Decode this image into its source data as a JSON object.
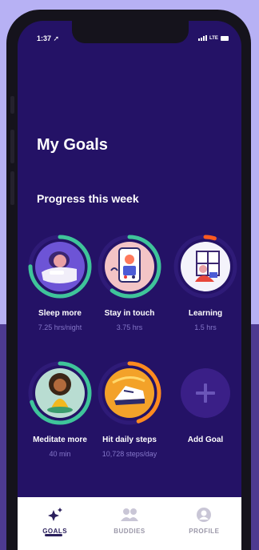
{
  "status": {
    "time": "1:37",
    "network": "LTE"
  },
  "header": {
    "title": "My Goals",
    "subtitle": "Progress this week"
  },
  "goals": [
    {
      "label": "Sleep more",
      "value": "7.25 hrs/night",
      "progress": 0.75,
      "icon": "sleeping-person-icon",
      "color": "#3fc49a"
    },
    {
      "label": "Stay in touch",
      "value": "3.75 hrs",
      "progress": 0.6,
      "icon": "video-call-phone-icon",
      "color": "#3fc49a"
    },
    {
      "label": "Learning",
      "value": "1.5 hrs",
      "progress": 0.05,
      "icon": "reading-person-icon",
      "color": "#ff5a1f"
    },
    {
      "label": "Meditate more",
      "value": "40 min",
      "progress": 0.7,
      "icon": "meditating-person-icon",
      "color": "#3fc49a"
    },
    {
      "label": "Hit daily steps",
      "value": "10,728 steps/day",
      "progress": 0.45,
      "icon": "shoe-steps-icon",
      "color": "#ff8a1f"
    },
    {
      "label": "Add Goal",
      "value": "",
      "icon": "plus-icon"
    }
  ],
  "tabs": [
    {
      "label": "GOALS",
      "icon": "sparkle-star-icon",
      "active": true
    },
    {
      "label": "BUDDIES",
      "icon": "buddies-icon",
      "active": false
    },
    {
      "label": "PROFILE",
      "icon": "profile-icon",
      "active": false
    }
  ]
}
